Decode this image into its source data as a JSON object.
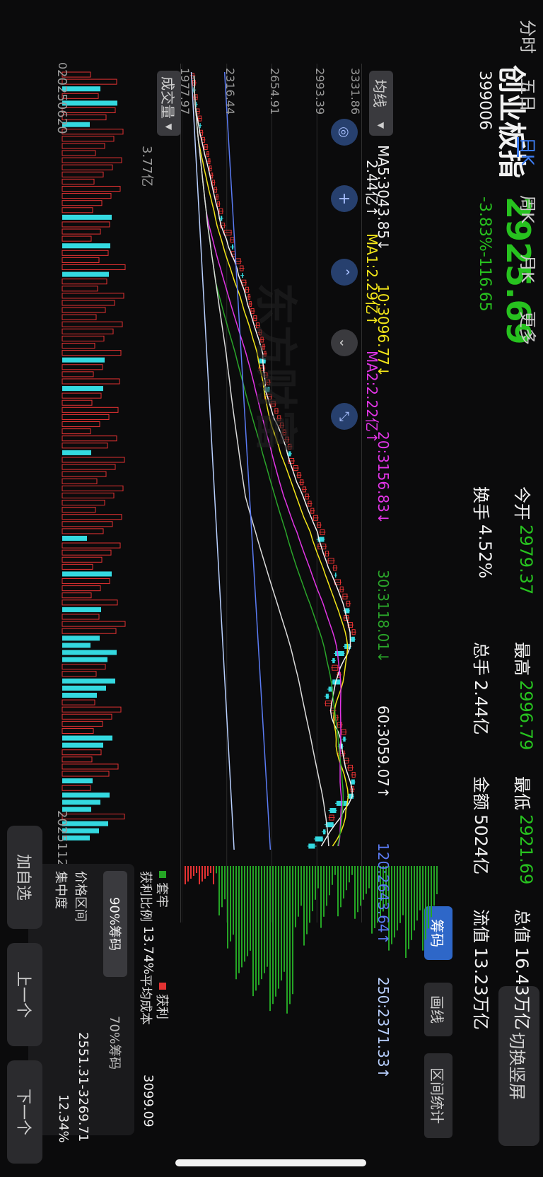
{
  "header": {
    "name": "创业板指",
    "code": "399006",
    "price": "2925.69",
    "change": "-3.83%-116.65",
    "stats": [
      {
        "label": "今开",
        "value": "2979.37",
        "cls": "green"
      },
      {
        "label": "最高",
        "value": "2996.79",
        "cls": "green"
      },
      {
        "label": "最低",
        "value": "2921.69",
        "cls": "green"
      },
      {
        "label": "总值",
        "value": "16.43万亿",
        "cls": "white"
      },
      {
        "label": "换手",
        "value": "4.52%",
        "cls": "white"
      },
      {
        "label": "总手",
        "value": "2.44亿",
        "cls": "white"
      },
      {
        "label": "金额",
        "value": "5024亿",
        "cls": "white"
      },
      {
        "label": "流值",
        "value": "13.23万亿",
        "cls": "white"
      }
    ],
    "switch_label": "切换竖屏"
  },
  "ma_bar": {
    "selector_label": "均线",
    "items": [
      {
        "text": "MA5:3043.85↓",
        "color": "#f2f2f2"
      },
      {
        "text": "10:3096.77↓",
        "color": "#f3e619"
      },
      {
        "text": "20:3156.83↓",
        "color": "#e235e6"
      },
      {
        "text": "30:3118.01↓",
        "color": "#2aa52a"
      },
      {
        "text": "60:3059.07↑",
        "color": "#f2f2f2"
      },
      {
        "text": "120:2643.64↑",
        "color": "#5b7cf5"
      },
      {
        "text": "250:2371.33↑",
        "color": "#b9d0ff"
      }
    ]
  },
  "price_axis": {
    "labels": [
      "3331.86",
      "2993.39",
      "2654.91",
      "2316.44",
      "1977.97"
    ]
  },
  "volume_bar": {
    "selector_label": "成交量",
    "items": [
      {
        "text": "2.44亿↑",
        "color": "#f2f2f2"
      },
      {
        "text": "MA1:2.29亿↑",
        "color": "#f3e619"
      },
      {
        "text": "MA2:2.22亿↑",
        "color": "#e235e6"
      }
    ],
    "axis_top": "3.77亿",
    "axis_bottom": "0",
    "date_start": "20250620",
    "date_end": "20251121"
  },
  "side_tabs": {
    "items": [
      "筹码",
      "画线",
      "区间统计"
    ]
  },
  "chips": {
    "legend_loss": "套牢",
    "legend_profit": "获利",
    "rows": [
      {
        "label": "获利比例",
        "value": "13.74%"
      },
      {
        "label": "平均成本",
        "value": "3099.09"
      },
      {
        "label": "价格区间",
        "value": "2551.31-3269.71"
      },
      {
        "label": "集中度",
        "value": "12.34%"
      }
    ],
    "tab_90": "90%筹码",
    "tab_70": "70%筹码"
  },
  "bottom_tabs": {
    "items": [
      "分时",
      "五日",
      "日K",
      "周K",
      "月K",
      "更多"
    ],
    "active": 2
  },
  "actions": {
    "add": "加自选",
    "prev": "上一个",
    "next": "下一个"
  },
  "chart_data": {
    "type": "candlestick",
    "x_start": "20250620",
    "x_end": "20251121",
    "ylim": [
      1977.97,
      3331.86
    ],
    "y_ticks": [
      3331.86,
      2993.39,
      2654.91,
      2316.44,
      1977.97
    ],
    "candles": [
      [
        2050,
        2070,
        2040,
        2080
      ],
      [
        2060,
        2080,
        2050,
        2090
      ],
      [
        2075,
        2065,
        2055,
        2085
      ],
      [
        2070,
        2095,
        2062,
        2100
      ],
      [
        2090,
        2085,
        2078,
        2098
      ],
      [
        2085,
        2110,
        2080,
        2115
      ],
      [
        2105,
        2125,
        2098,
        2130
      ],
      [
        2120,
        2115,
        2108,
        2128
      ],
      [
        2115,
        2135,
        2110,
        2140
      ],
      [
        2130,
        2150,
        2125,
        2156
      ],
      [
        2148,
        2170,
        2140,
        2176
      ],
      [
        2168,
        2180,
        2160,
        2186
      ],
      [
        2178,
        2190,
        2170,
        2196
      ],
      [
        2188,
        2200,
        2180,
        2206
      ],
      [
        2198,
        2210,
        2190,
        2216
      ],
      [
        2208,
        2225,
        2200,
        2230
      ],
      [
        2222,
        2240,
        2215,
        2246
      ],
      [
        2238,
        2250,
        2230,
        2256
      ],
      [
        2248,
        2262,
        2240,
        2268
      ],
      [
        2260,
        2285,
        2252,
        2292
      ],
      [
        2282,
        2270,
        2255,
        2290
      ],
      [
        2268,
        2300,
        2262,
        2308
      ],
      [
        2298,
        2350,
        2290,
        2356
      ],
      [
        2346,
        2370,
        2338,
        2376
      ],
      [
        2366,
        2355,
        2340,
        2372
      ],
      [
        2352,
        2380,
        2345,
        2386
      ],
      [
        2378,
        2420,
        2370,
        2428
      ],
      [
        2416,
        2440,
        2410,
        2448
      ],
      [
        2438,
        2430,
        2420,
        2446
      ],
      [
        2428,
        2460,
        2422,
        2466
      ],
      [
        2458,
        2480,
        2450,
        2486
      ],
      [
        2478,
        2490,
        2470,
        2496
      ],
      [
        2488,
        2500,
        2480,
        2508
      ],
      [
        2498,
        2520,
        2490,
        2528
      ],
      [
        2518,
        2540,
        2510,
        2546
      ],
      [
        2538,
        2560,
        2530,
        2566
      ],
      [
        2558,
        2575,
        2550,
        2582
      ],
      [
        2572,
        2590,
        2565,
        2598
      ],
      [
        2588,
        2600,
        2578,
        2606
      ],
      [
        2598,
        2610,
        2590,
        2618
      ],
      [
        2608,
        2560,
        2550,
        2612
      ],
      [
        2560,
        2600,
        2552,
        2606
      ],
      [
        2598,
        2620,
        2588,
        2628
      ],
      [
        2618,
        2640,
        2610,
        2648
      ],
      [
        2638,
        2600,
        2590,
        2642
      ],
      [
        2602,
        2650,
        2596,
        2656
      ],
      [
        2648,
        2680,
        2640,
        2688
      ],
      [
        2678,
        2700,
        2670,
        2708
      ],
      [
        2698,
        2720,
        2690,
        2728
      ],
      [
        2718,
        2740,
        2710,
        2748
      ],
      [
        2738,
        2760,
        2730,
        2766
      ],
      [
        2758,
        2780,
        2750,
        2786
      ],
      [
        2778,
        2800,
        2770,
        2808
      ],
      [
        2798,
        2780,
        2770,
        2806
      ],
      [
        2782,
        2820,
        2775,
        2828
      ],
      [
        2818,
        2850,
        2810,
        2858
      ],
      [
        2848,
        2870,
        2840,
        2878
      ],
      [
        2868,
        2890,
        2860,
        2898
      ],
      [
        2888,
        2910,
        2880,
        2918
      ],
      [
        2908,
        2930,
        2900,
        2938
      ],
      [
        2928,
        2950,
        2920,
        2958
      ],
      [
        2948,
        2970,
        2940,
        2978
      ],
      [
        2968,
        3000,
        2960,
        3006
      ],
      [
        2998,
        3020,
        2990,
        3028
      ],
      [
        3018,
        3050,
        3010,
        3058
      ],
      [
        3048,
        3000,
        2990,
        3052
      ],
      [
        3002,
        3060,
        2995,
        3068
      ],
      [
        3058,
        3080,
        3050,
        3088
      ],
      [
        3078,
        3120,
        3070,
        3128
      ],
      [
        3118,
        3140,
        3110,
        3148
      ],
      [
        3138,
        3130,
        3120,
        3146
      ],
      [
        3128,
        3170,
        3120,
        3178
      ],
      [
        3168,
        3190,
        3160,
        3198
      ],
      [
        3188,
        3220,
        3180,
        3228
      ],
      [
        3218,
        3240,
        3210,
        3248
      ],
      [
        3238,
        3200,
        3190,
        3242
      ],
      [
        3198,
        3230,
        3190,
        3238
      ],
      [
        3228,
        3260,
        3220,
        3268
      ],
      [
        3258,
        3280,
        3250,
        3288
      ],
      [
        3278,
        3250,
        3240,
        3282
      ],
      [
        3248,
        3200,
        3190,
        3252
      ],
      [
        3198,
        3130,
        3120,
        3202
      ],
      [
        3128,
        3110,
        3100,
        3134
      ],
      [
        3108,
        3150,
        3100,
        3158
      ],
      [
        3148,
        3170,
        3140,
        3178
      ],
      [
        3168,
        3110,
        3100,
        3172
      ],
      [
        3112,
        3080,
        3070,
        3116
      ],
      [
        3082,
        3060,
        3050,
        3086
      ],
      [
        3058,
        3100,
        3050,
        3108
      ],
      [
        3098,
        3130,
        3090,
        3138
      ],
      [
        3128,
        3150,
        3120,
        3158
      ],
      [
        3148,
        3180,
        3140,
        3188
      ],
      [
        3178,
        3210,
        3170,
        3218
      ],
      [
        3208,
        3190,
        3180,
        3216
      ],
      [
        3188,
        3160,
        3150,
        3192
      ],
      [
        3158,
        3200,
        3150,
        3208
      ],
      [
        3198,
        3230,
        3190,
        3238
      ],
      [
        3228,
        3260,
        3220,
        3268
      ],
      [
        3258,
        3280,
        3250,
        3288
      ],
      [
        3278,
        3250,
        3240,
        3282
      ],
      [
        3248,
        3270,
        3240,
        3278
      ],
      [
        3268,
        3230,
        3220,
        3272
      ],
      [
        3228,
        3140,
        3130,
        3232
      ],
      [
        3138,
        3090,
        3080,
        3142
      ],
      [
        3088,
        3120,
        3080,
        3128
      ],
      [
        3118,
        3060,
        3050,
        3122
      ],
      [
        3058,
        3040,
        3030,
        3062
      ],
      [
        3038,
        2980,
        2970,
        3042
      ],
      [
        2978,
        2930,
        2921,
        2990
      ]
    ]
  }
}
